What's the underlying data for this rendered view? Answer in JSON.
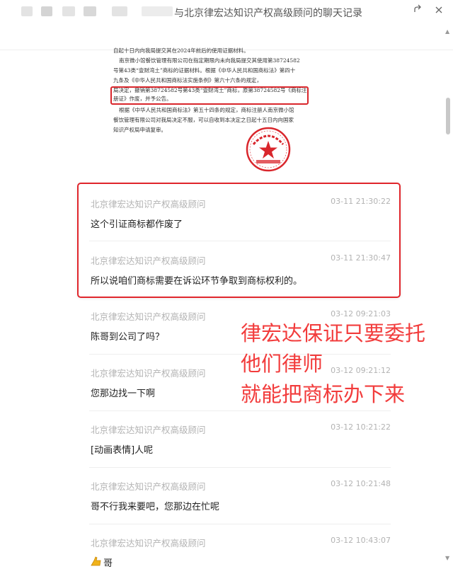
{
  "window": {
    "title": "与北京律宏达知识产权高级顾问的聊天记录"
  },
  "document": {
    "lines": [
      "自起十日内向我局提交其在2024年前后的使用证据材料。",
      "南京微小馆餐饮管理有限公司在指定期限内未向我局提交其使用第38724582",
      "号第43类“壹财湾土”商标的证据材料。根据《中华人民共和国商标法》第四十",
      "九条及《中华人民共和国商标法实施条例》第六十六条的规定，",
      "局决定，撤销第38724582号第43类“壹财湾土”商标，原第38724582号《商标注",
      "册证》作废，并予公告。",
      "根据《中华人民共和国商标法》第五十四条的规定，商标注册人南京微小馆",
      "餐饮管理有限公司对我局决定不服，可以自收到本决定之日起十五日内向国家",
      "知识产权局申请复审。"
    ],
    "seal_text": "国家知识产权局"
  },
  "messages": [
    {
      "sender": "北京律宏达知识产权高级顾问",
      "time": "03-11 21:30:22",
      "text": "这个引证商标都作废了"
    },
    {
      "sender": "北京律宏达知识产权高级顾问",
      "time": "03-11 21:30:47",
      "text": "所以说咱们商标需要在诉讼环节争取到商标权利的。"
    },
    {
      "sender": "北京律宏达知识产权高级顾问",
      "time": "03-12 09:21:03",
      "text": "陈哥到公司了吗？"
    },
    {
      "sender": "北京律宏达知识产权高级顾问",
      "time": "03-12 09:21:12",
      "text": "您那边找一下啊"
    },
    {
      "sender": "北京律宏达知识产权高级顾问",
      "time": "03-12 10:21:22",
      "text": "[动画表情]人呢"
    },
    {
      "sender": "北京律宏达知识产权高级顾问",
      "time": "03-12 10:21:48",
      "text": "哥不行我来要吧，您那边在忙呢"
    },
    {
      "sender": "北京律宏达知识产权高级顾问",
      "time": "03-12 10:43:07",
      "text": "哥"
    }
  ],
  "annotation": {
    "lines": [
      "律宏达保证只要委托",
      "他们律师",
      "就能把商标办下来"
    ],
    "color": "#f23c3c"
  },
  "colors": {
    "highlight_border": "#e0262c",
    "seal_red": "#d9262c"
  },
  "icons": {
    "share": "share-icon",
    "close": "close-icon",
    "emoji": "thumbs-up-emoji-icon"
  }
}
